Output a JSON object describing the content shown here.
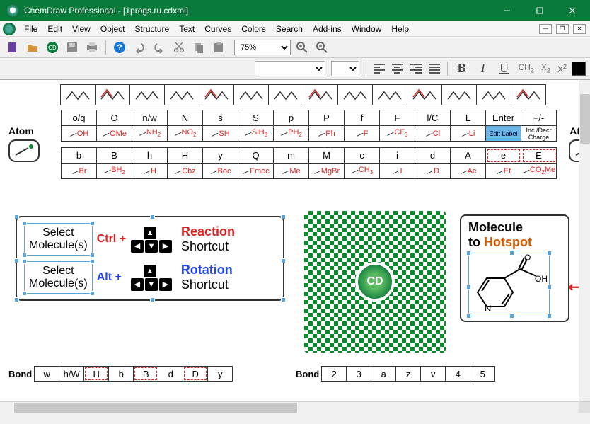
{
  "title": "ChemDraw Professional - [1progs.ru.cdxml]",
  "menu": [
    "File",
    "Edit",
    "View",
    "Object",
    "Structure",
    "Text",
    "Curves",
    "Colors",
    "Search",
    "Add-ins",
    "Window",
    "Help"
  ],
  "zoom": "75%",
  "qr_center": "CD",
  "atom_label": "Atom",
  "atom_label_r": "Ator",
  "row1_keys": [
    "o/q",
    "O",
    "n/w",
    "N",
    "s",
    "S",
    "p",
    "P",
    "f",
    "F",
    "l/C",
    "L",
    "Enter",
    "+/-"
  ],
  "row1_labels": [
    "OH",
    "OMe",
    "NH₂",
    "NO₂",
    "SH",
    "SiH₃",
    "PH₂",
    "Ph",
    "F",
    "CF₃",
    "Cl",
    "Li",
    "Edit Label",
    "Inc./Decr Charge"
  ],
  "row2_keys": [
    "b",
    "B",
    "h",
    "H",
    "y",
    "Q",
    "m",
    "M",
    "c",
    "i",
    "d",
    "A",
    "e",
    "E"
  ],
  "row2_labels": [
    "Br",
    "BH₂",
    "H",
    "Cbz",
    "Boc",
    "Fmoc",
    "Me",
    "MgBr",
    "CH₃",
    "I",
    "D",
    "Ac",
    "Et",
    "CO₂Me"
  ],
  "shortcut": {
    "select": "Select\nMolecule(s)",
    "ctrl": "Ctrl +",
    "alt": "Alt +",
    "reaction": "Reaction",
    "rotation": "Rotation",
    "sub": "Shortcut"
  },
  "molecule": {
    "title1": "Molecule",
    "title2": "to ",
    "hotspot": "Hotspot"
  },
  "bond_label": "Bond",
  "bond1": [
    "w",
    "h/W",
    "H",
    "b",
    "B",
    "d",
    "D",
    "y"
  ],
  "bond2": [
    "2",
    "3",
    "a",
    "z",
    "v",
    "4",
    "5"
  ]
}
